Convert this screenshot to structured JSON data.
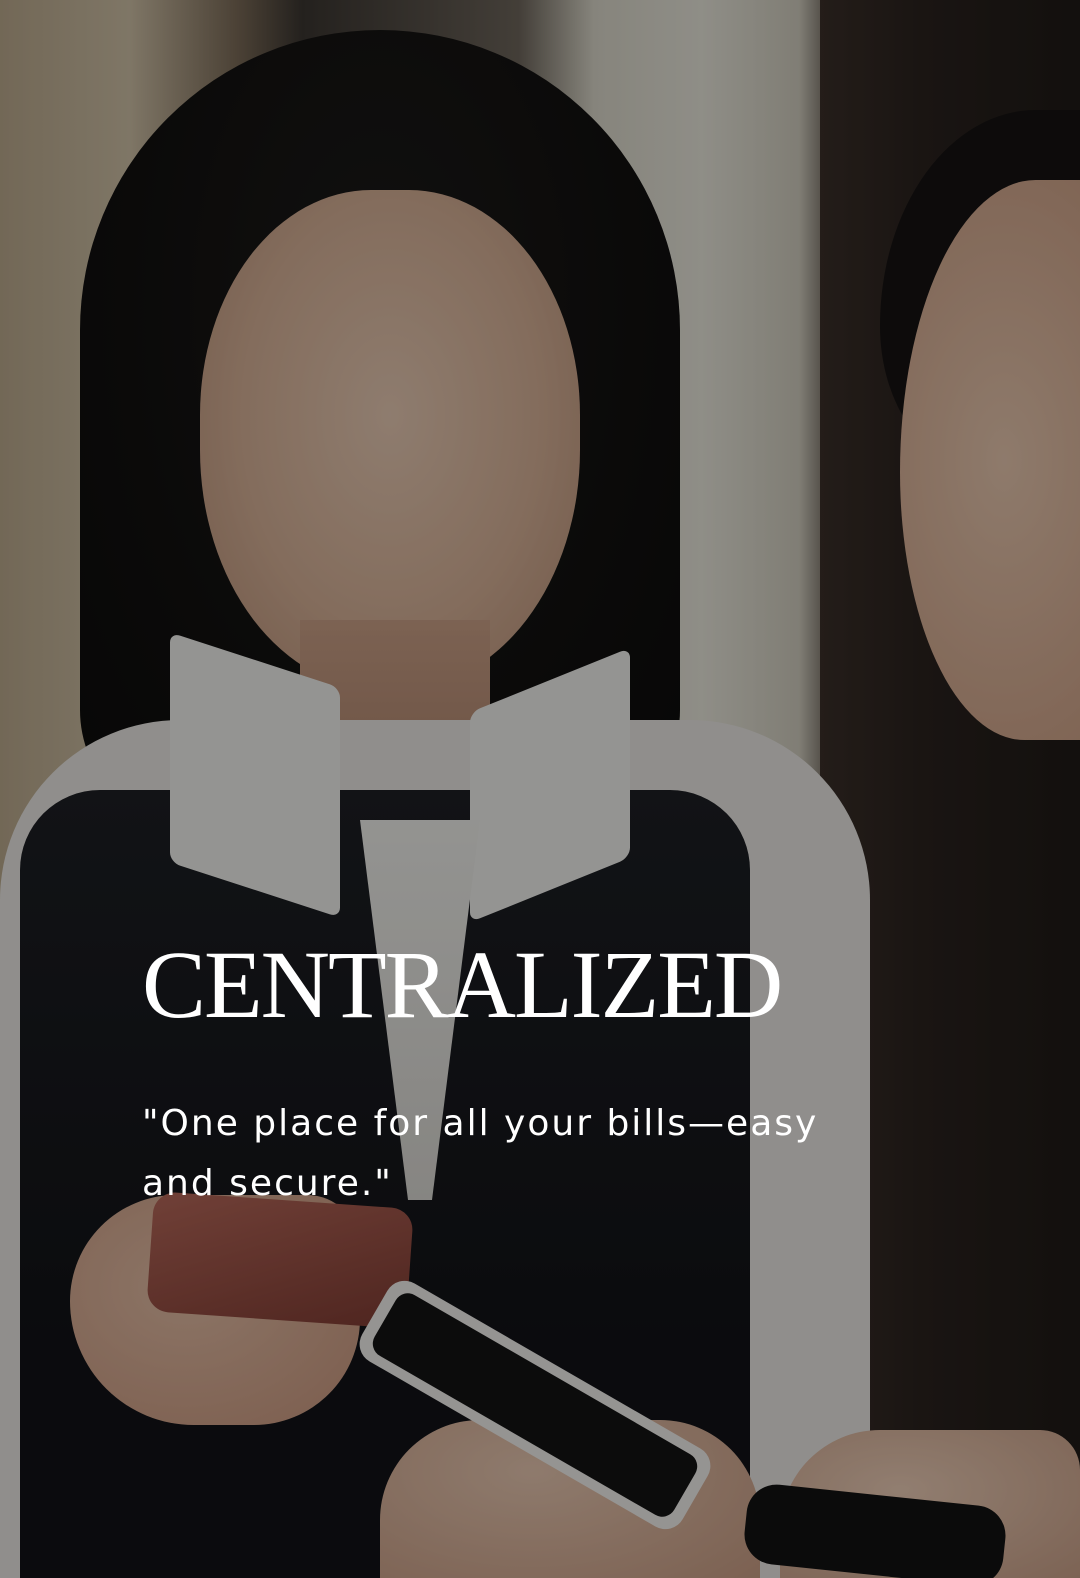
{
  "hero": {
    "image_label": "two-women-using-phones-photo",
    "overlay_color": "#000000",
    "headline": "CENTRALIZED",
    "tagline": "\"One place for all your bills—easy and secure.\"",
    "text_color": "#ffffff"
  }
}
